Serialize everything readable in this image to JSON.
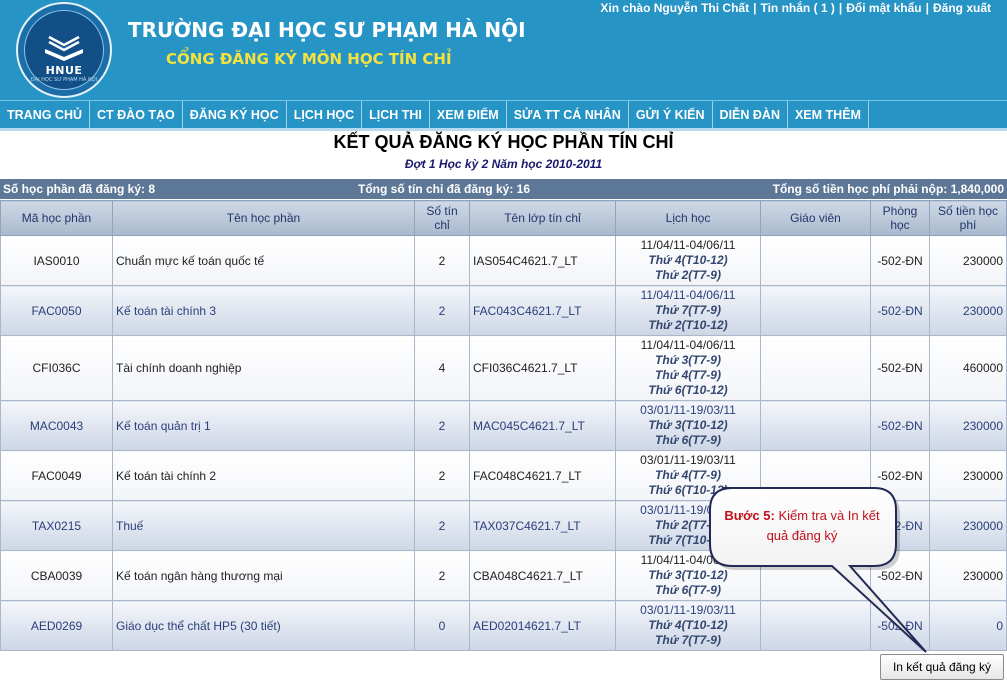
{
  "header": {
    "logo_text": "HNUE",
    "logo_sub": "ĐẠI HỌC SƯ PHẠM HÀ NỘI",
    "school_name": "TRƯỜNG ĐẠI HỌC SƯ PHẠM HÀ NỘI",
    "portal_name": "CỔNG ĐĂNG KÝ MÔN HỌC TÍN CHỈ",
    "greeting": "Xin chào Nguyễn Thi Chất",
    "messages": "Tin nhắn ( 1 )",
    "change_password": "Đổi mật khẩu",
    "logout": "Đăng xuất"
  },
  "nav": [
    "TRANG CHỦ",
    "CT ĐÀO TẠO",
    "ĐĂNG KÝ HỌC",
    "LỊCH HỌC",
    "LỊCH THI",
    "XEM ĐIỂM",
    "SỬA TT CÁ NHÂN",
    "GỬI Ý KIẾN",
    "DIỄN ĐÀN",
    "XEM THÊM"
  ],
  "page": {
    "title": "KẾT QUẢ ĐĂNG KÝ HỌC PHẦN TÍN CHỈ",
    "subtitle": "Đợt 1 Học kỳ 2 Năm học 2010-2011"
  },
  "summary": {
    "courses": "Số học phần đã đăng ký: 8",
    "credits": "Tổng số tín chỉ đã đăng ký: 16",
    "fee": "Tổng số tiền học phí phải nộp: 1,840,000"
  },
  "table": {
    "headers": [
      "Mã học phần",
      "Tên học phần",
      "Số tín chỉ",
      "Tên lớp tín chỉ",
      "Lịch học",
      "Giáo viên",
      "Phòng học",
      "Số tiền học phí"
    ],
    "rows": [
      {
        "code": "IAS0010",
        "name": "Chuẩn mực kế toán quốc tế",
        "credits": "2",
        "class": "IAS054C4621.7_LT",
        "dates": "11/04/11-04/06/11",
        "days": [
          "Thứ 4(T10-12)",
          "Thứ 2(T7-9)"
        ],
        "teacher": "",
        "room": "-502-ĐN",
        "fee": "230000"
      },
      {
        "code": "FAC0050",
        "name": "Kế toán tài chính 3",
        "credits": "2",
        "class": "FAC043C4621.7_LT",
        "dates": "11/04/11-04/06/11",
        "days": [
          "Thứ 7(T7-9)",
          "Thứ 2(T10-12)"
        ],
        "teacher": "",
        "room": "-502-ĐN",
        "fee": "230000"
      },
      {
        "code": "CFI036C",
        "name": "Tài chính doanh nghiệp",
        "credits": "4",
        "class": "CFI036C4621.7_LT",
        "dates": "11/04/11-04/06/11",
        "days": [
          "Thứ 3(T7-9)",
          "Thứ 4(T7-9)",
          "Thứ 6(T10-12)"
        ],
        "teacher": "",
        "room": "-502-ĐN",
        "fee": "460000"
      },
      {
        "code": "MAC0043",
        "name": "Kế toán quản trị 1",
        "credits": "2",
        "class": "MAC045C4621.7_LT",
        "dates": "03/01/11-19/03/11",
        "days": [
          "Thứ 3(T10-12)",
          "Thứ 6(T7-9)"
        ],
        "teacher": "",
        "room": "-502-ĐN",
        "fee": "230000"
      },
      {
        "code": "FAC0049",
        "name": "Kế toán tài chính 2",
        "credits": "2",
        "class": "FAC048C4621.7_LT",
        "dates": "03/01/11-19/03/11",
        "days": [
          "Thứ 4(T7-9)",
          "Thứ 6(T10-12)"
        ],
        "teacher": "",
        "room": "-502-ĐN",
        "fee": "230000"
      },
      {
        "code": "TAX0215",
        "name": "Thuế",
        "credits": "2",
        "class": "TAX037C4621.7_LT",
        "dates": "03/01/11-19/03/11",
        "days": [
          "Thứ 2(T7-9)",
          "Thứ 7(T10-12)"
        ],
        "teacher": "",
        "room": "-502-ĐN",
        "fee": "230000"
      },
      {
        "code": "CBA0039",
        "name": "Kế toán ngân hàng thương mại",
        "credits": "2",
        "class": "CBA048C4621.7_LT",
        "dates": "11/04/11-04/06/11",
        "days": [
          "Thứ 3(T10-12)",
          "Thứ 6(T7-9)"
        ],
        "teacher": "",
        "room": "-502-ĐN",
        "fee": "230000"
      },
      {
        "code": "AED0269",
        "name": "Giáo dục thể chất HP5 (30 tiết)",
        "credits": "0",
        "class": "AED02014621.7_LT",
        "dates": "03/01/11-19/03/11",
        "days": [
          "Thứ 4(T10-12)",
          "Thứ 7(T7-9)"
        ],
        "teacher": "",
        "room": "-502-ĐN",
        "fee": "0"
      }
    ]
  },
  "callout": {
    "step": "Bước 5:",
    "text": "Kiểm tra và In kết quả đăng ký"
  },
  "print_button": "In kết quả đăng ký",
  "colors": {
    "header_bg": "#2794c6",
    "portal_yellow": "#f4e23e",
    "summary_bg": "#5d7896",
    "callout_red": "#c0101a"
  }
}
